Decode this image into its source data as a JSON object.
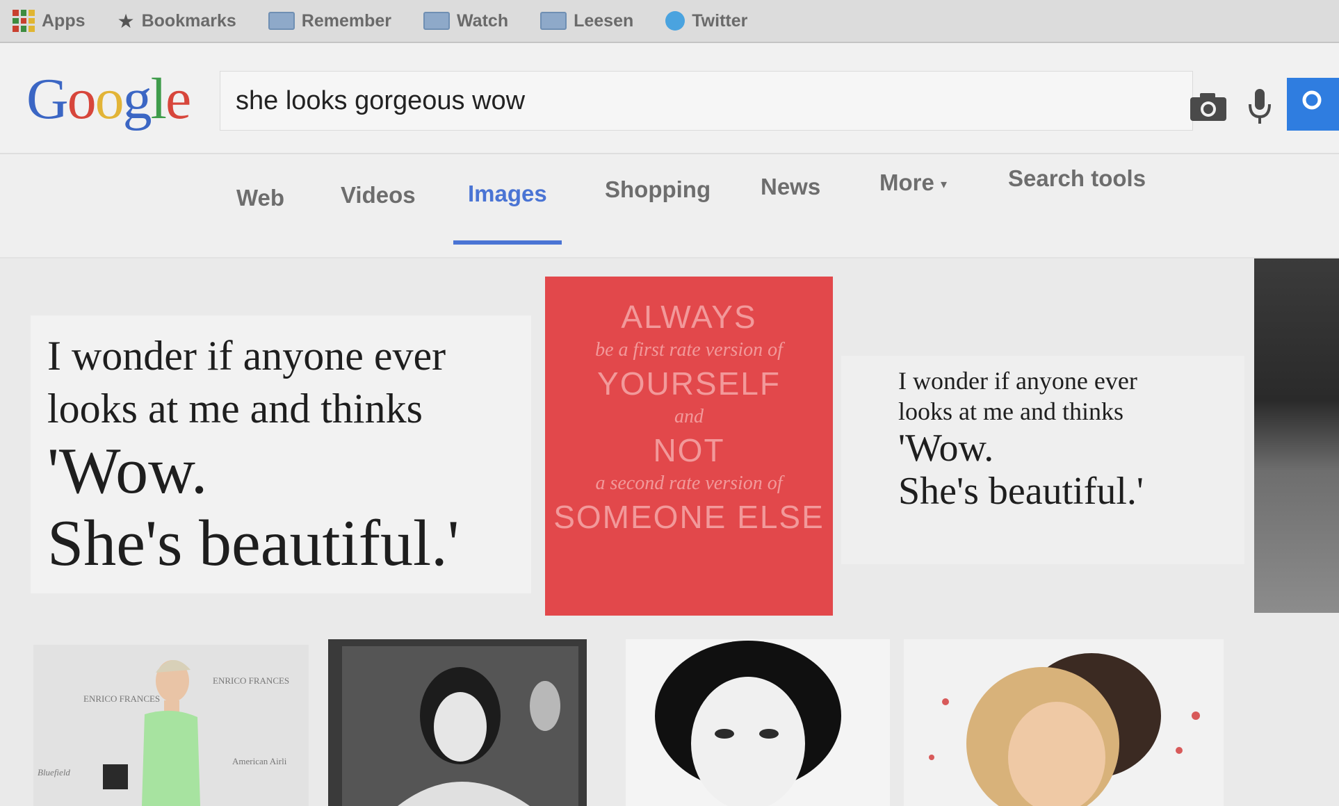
{
  "bookmarks_bar": {
    "items": [
      {
        "label": "Apps",
        "icon": "apps-grid-icon"
      },
      {
        "label": "Bookmarks",
        "icon": "star-icon"
      },
      {
        "label": "Remember",
        "icon": "folder-icon"
      },
      {
        "label": "Watch",
        "icon": "folder-icon"
      },
      {
        "label": "Leesen",
        "icon": "folder-icon"
      },
      {
        "label": "Twitter",
        "icon": "twitter-bird-icon"
      }
    ]
  },
  "header": {
    "logo_letters": [
      "G",
      "o",
      "o",
      "g",
      "l",
      "e"
    ],
    "search_query": "she looks gorgeous wow",
    "icons": [
      "camera-icon",
      "microphone-icon",
      "search-icon"
    ],
    "accent_color": "#2f7de0"
  },
  "nav": {
    "tabs": [
      {
        "label": "Web"
      },
      {
        "label": "Videos"
      },
      {
        "label": "Images",
        "active": true
      },
      {
        "label": "Shopping"
      },
      {
        "label": "News"
      },
      {
        "label": "More"
      }
    ],
    "search_tools": "Search tools",
    "active_color": "#4a74d4"
  },
  "results": {
    "quote_large": {
      "lines": [
        "I wonder if anyone ever",
        "looks at me and thinks",
        "'Wow.",
        "She's beautiful.'"
      ]
    },
    "quote_red": {
      "lines": [
        "ALWAYS",
        "be a first rate version of",
        "YOURSELF",
        "and",
        "NOT",
        "a second rate version of",
        "SOMEONE ELSE"
      ],
      "background": "#e2484b"
    },
    "quote_small": {
      "lines": [
        "I wonder if anyone ever",
        "looks at me and thinks",
        "'Wow.",
        "She's beautiful.'"
      ]
    },
    "photo_labels": {
      "miley_backdrop_1": "ENRICO FRANCES",
      "miley_backdrop_2": "ENRICO FRANCES",
      "miley_backdrop_3": "Bluefield",
      "miley_backdrop_4": "American Airli"
    }
  }
}
